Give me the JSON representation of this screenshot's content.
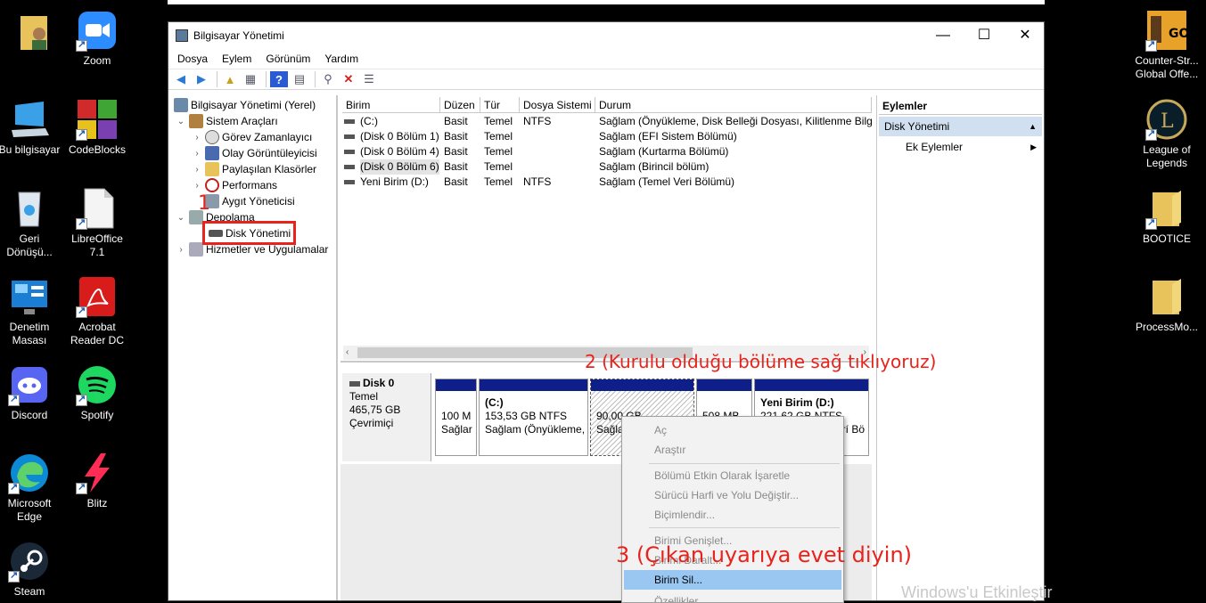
{
  "desktop": {
    "left_icons": [
      {
        "name": "user-folder",
        "label": ""
      },
      {
        "name": "zoom",
        "label": "Zoom"
      },
      {
        "name": "this-pc",
        "label": "Bu bilgisayar"
      },
      {
        "name": "codeblocks",
        "label": "CodeBlocks"
      },
      {
        "name": "recycle-bin",
        "label": "Geri Dönüşü..."
      },
      {
        "name": "libreoffice",
        "label": "LibreOffice 7.1"
      },
      {
        "name": "control-panel",
        "label": "Denetim Masası"
      },
      {
        "name": "acrobat",
        "label": "Acrobat Reader DC"
      },
      {
        "name": "discord",
        "label": "Discord"
      },
      {
        "name": "spotify",
        "label": "Spotify"
      },
      {
        "name": "edge",
        "label": "Microsoft Edge"
      },
      {
        "name": "blitz",
        "label": "Blitz"
      },
      {
        "name": "steam",
        "label": "Steam"
      }
    ],
    "right_icons": [
      {
        "name": "csgo",
        "label": "Counter-Str... Global Offe..."
      },
      {
        "name": "league",
        "label": "League of Legends"
      },
      {
        "name": "bootice",
        "label": "BOOTICE"
      },
      {
        "name": "processmon",
        "label": "ProcessMo..."
      }
    ],
    "watermark": "Windows'u Etkinleştir"
  },
  "window": {
    "title": "Bilgisayar Yönetimi",
    "minimize": "—",
    "maximize": "☐",
    "close": "✕",
    "menu": [
      "Dosya",
      "Eylem",
      "Görünüm",
      "Yardım"
    ]
  },
  "tree": {
    "root": "Bilgisayar Yönetimi (Yerel)",
    "system_tools": "Sistem Araçları",
    "task_scheduler": "Görev Zamanlayıcı",
    "event_viewer": "Olay Görüntüleyicisi",
    "shared_folders": "Paylaşılan Klasörler",
    "performance": "Performans",
    "device_manager": "Aygıt Yöneticisi",
    "storage": "Depolama",
    "disk_management": "Disk Yönetimi",
    "services": "Hizmetler ve Uygulamalar"
  },
  "volume_list": {
    "headers": [
      "Birim",
      "Düzen",
      "Tür",
      "Dosya Sistemi",
      "Durum"
    ],
    "rows": [
      {
        "birim": "(C:)",
        "duzen": "Basit",
        "tur": "Temel",
        "fs": "NTFS",
        "durum": "Sağlam (Önyükleme, Disk Belleği Dosyası, Kilitlenme Bilgis"
      },
      {
        "birim": "(Disk 0 Bölüm 1)",
        "duzen": "Basit",
        "tur": "Temel",
        "fs": "",
        "durum": "Sağlam (EFI Sistem Bölümü)"
      },
      {
        "birim": "(Disk 0 Bölüm 4)",
        "duzen": "Basit",
        "tur": "Temel",
        "fs": "",
        "durum": "Sağlam (Kurtarma Bölümü)"
      },
      {
        "birim": "(Disk 0 Bölüm 6)",
        "duzen": "Basit",
        "tur": "Temel",
        "fs": "",
        "durum": "Sağlam (Birincil bölüm)"
      },
      {
        "birim": "Yeni Birim (D:)",
        "duzen": "Basit",
        "tur": "Temel",
        "fs": "NTFS",
        "durum": "Sağlam (Temel Veri Bölümü)"
      }
    ]
  },
  "disk": {
    "name": "Disk 0",
    "type": "Temel",
    "size": "465,75 GB",
    "status": "Çevrimiçi",
    "partitions": [
      {
        "line1": "",
        "line2": "100 M",
        "line3": "Sağlar"
      },
      {
        "line1": "(C:)",
        "line2": "153,53 GB NTFS",
        "line3": "Sağlam (Önyükleme,"
      },
      {
        "line1": "",
        "line2": "90,00 GB",
        "line3": "Sağla"
      },
      {
        "line1": "",
        "line2": "508 MB",
        "line3": ""
      },
      {
        "line1": "Yeni Birim  (D:)",
        "line2": "221,62 GB NTFS",
        "line3": "rí Bö"
      }
    ]
  },
  "actions": {
    "header": "Eylemler",
    "section": "Disk Yönetimi",
    "more": "Ek Eylemler"
  },
  "context_menu": {
    "items": [
      "Aç",
      "Araştır",
      "Bölümü Etkin Olarak İşaretle",
      "Sürücü Harfi ve Yolu Değiştir...",
      "Biçimlendir...",
      "Birimi Genişlet...",
      "Birimi Daralt...",
      "Birim Sil...",
      "Özellikler"
    ]
  },
  "annotations": {
    "one": "1",
    "two": "2 (Kurulu olduğu bölüme sağ tıklıyoruz)",
    "three": "3 (Çıkan uyarıya evet diyin)"
  },
  "colors": {
    "annotation_red": "#e8231c",
    "partition_bar": "#0f1f8a",
    "menu_highlight": "#99c7f2",
    "action_section": "#d0e0f0"
  }
}
